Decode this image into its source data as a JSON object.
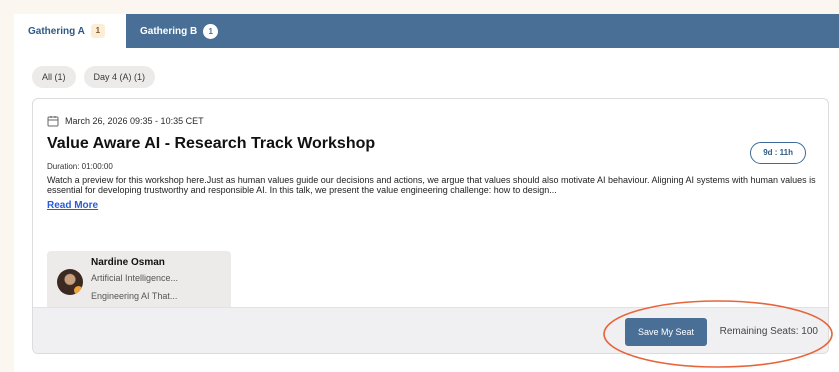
{
  "tabs": [
    {
      "label": "Gathering A",
      "count": "1"
    },
    {
      "label": "Gathering B",
      "count": "1"
    }
  ],
  "filters": [
    "All (1)",
    "Day 4 (A) (1)"
  ],
  "event": {
    "date": "March 26, 2026 09:35 - 10:35 CET",
    "title": "Value Aware AI - Research Track Workshop",
    "countdown": "9d : 11h",
    "duration": "Duration: 01:00:00",
    "description": "Watch a preview for this workshop here.Just as human values guide our decisions and actions, we argue that values should also motivate AI behaviour. Aligning AI systems with human values is essential for developing trustworthy and responsible AI. In this talk, we present the value engineering challenge: how to design...",
    "read_more": "Read More",
    "speaker": {
      "name": "Nardine Osman",
      "line1": "Artificial Intelligence...",
      "line2": "Engineering AI That..."
    }
  },
  "footer": {
    "save_label": "Save My Seat",
    "remaining": "Remaining Seats: 100"
  },
  "colors": {
    "accent": "#4a6f96",
    "link": "#2a5bd7",
    "highlight": "#e8643a",
    "page_bg": "#fbf6ef"
  },
  "icons": [
    "calendar-icon",
    "avatar"
  ]
}
